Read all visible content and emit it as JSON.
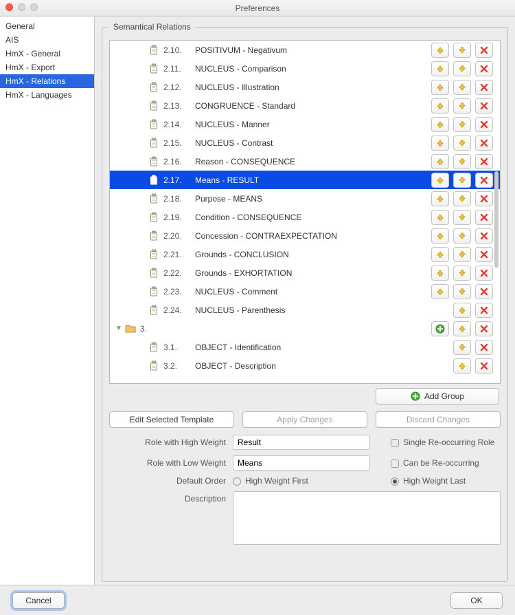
{
  "window": {
    "title": "Preferences"
  },
  "sidebar": {
    "items": [
      {
        "label": "General",
        "selected": false
      },
      {
        "label": "AIS",
        "selected": false
      },
      {
        "label": "HmX - General",
        "selected": false
      },
      {
        "label": "HmX - Export",
        "selected": false
      },
      {
        "label": "HmX - Relations",
        "selected": true
      },
      {
        "label": "HmX - Languages",
        "selected": false
      }
    ]
  },
  "group_title": "Semantical Relations",
  "rows": [
    {
      "kind": "item",
      "num": "2.10.",
      "label": "POSITIVUM - Negativum",
      "up": true,
      "down": true,
      "add": false,
      "del": true,
      "selected": false
    },
    {
      "kind": "item",
      "num": "2.11.",
      "label": "NUCLEUS - Comparison",
      "up": true,
      "down": true,
      "add": false,
      "del": true,
      "selected": false
    },
    {
      "kind": "item",
      "num": "2.12.",
      "label": "NUCLEUS - Illustration",
      "up": true,
      "down": true,
      "add": false,
      "del": true,
      "selected": false
    },
    {
      "kind": "item",
      "num": "2.13.",
      "label": "CONGRUENCE - Standard",
      "up": true,
      "down": true,
      "add": false,
      "del": true,
      "selected": false
    },
    {
      "kind": "item",
      "num": "2.14.",
      "label": "NUCLEUS - Manner",
      "up": true,
      "down": true,
      "add": false,
      "del": true,
      "selected": false
    },
    {
      "kind": "item",
      "num": "2.15.",
      "label": "NUCLEUS - Contrast",
      "up": true,
      "down": true,
      "add": false,
      "del": true,
      "selected": false
    },
    {
      "kind": "item",
      "num": "2.16.",
      "label": "Reason - CONSEQUENCE",
      "up": true,
      "down": true,
      "add": false,
      "del": true,
      "selected": false
    },
    {
      "kind": "item",
      "num": "2.17.",
      "label": "Means - RESULT",
      "up": true,
      "down": true,
      "add": false,
      "del": true,
      "selected": true
    },
    {
      "kind": "item",
      "num": "2.18.",
      "label": "Purpose - MEANS",
      "up": true,
      "down": true,
      "add": false,
      "del": true,
      "selected": false
    },
    {
      "kind": "item",
      "num": "2.19.",
      "label": "Condition - CONSEQUENCE",
      "up": true,
      "down": true,
      "add": false,
      "del": true,
      "selected": false
    },
    {
      "kind": "item",
      "num": "2.20.",
      "label": "Concession - CONTRAEXPECTATION",
      "up": true,
      "down": true,
      "add": false,
      "del": true,
      "selected": false
    },
    {
      "kind": "item",
      "num": "2.21.",
      "label": "Grounds - CONCLUSION",
      "up": true,
      "down": true,
      "add": false,
      "del": true,
      "selected": false
    },
    {
      "kind": "item",
      "num": "2.22.",
      "label": "Grounds - EXHORTATION",
      "up": true,
      "down": true,
      "add": false,
      "del": true,
      "selected": false
    },
    {
      "kind": "item",
      "num": "2.23.",
      "label": "NUCLEUS - Comment",
      "up": true,
      "down": true,
      "add": false,
      "del": true,
      "selected": false
    },
    {
      "kind": "item",
      "num": "2.24.",
      "label": "NUCLEUS - Parenthesis",
      "up": true,
      "down": false,
      "add": false,
      "del": true,
      "selected": false
    },
    {
      "kind": "folder",
      "num": "3.",
      "label": "",
      "up": true,
      "down": false,
      "add": true,
      "del": true,
      "selected": false
    },
    {
      "kind": "item",
      "num": "3.1.",
      "label": "OBJECT - Identification",
      "up": false,
      "down": true,
      "add": false,
      "del": true,
      "selected": false
    },
    {
      "kind": "item",
      "num": "3.2.",
      "label": "OBJECT - Description",
      "up": true,
      "down": false,
      "add": false,
      "del": true,
      "selected": false
    }
  ],
  "add_group_label": "Add Group",
  "buttons": {
    "edit": "Edit Selected Template",
    "apply": "Apply Changes",
    "discard": "Discard Changes"
  },
  "form": {
    "high_label": "Role with High Weight",
    "high_value": "Result",
    "low_label": "Role with Low Weight",
    "low_value": "Means",
    "order_label": "Default Order",
    "order_first": "High Weight First",
    "order_last": "High Weight Last",
    "single_label": "Single Re-occurring Role",
    "reoccur_label": "Can be Re-occurring",
    "desc_label": "Description",
    "desc_value": ""
  },
  "footer": {
    "cancel": "Cancel",
    "ok": "OK"
  }
}
